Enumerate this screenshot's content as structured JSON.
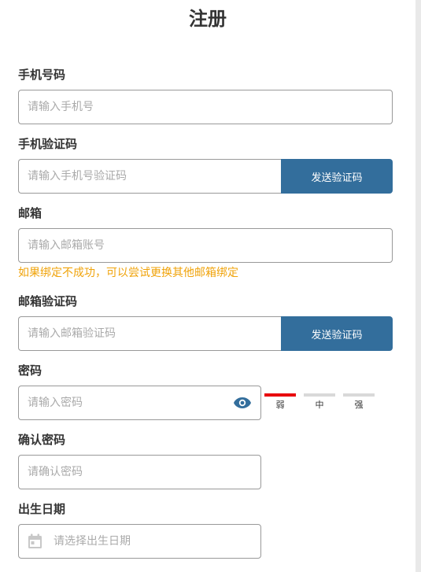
{
  "page": {
    "title": "注册"
  },
  "form": {
    "phone": {
      "label": "手机号码",
      "placeholder": "请输入手机号"
    },
    "phone_code": {
      "label": "手机验证码",
      "placeholder": "请输入手机号验证码",
      "button": "发送验证码"
    },
    "email": {
      "label": "邮箱",
      "placeholder": "请输入邮箱账号",
      "hint": "如果绑定不成功，可以尝试更换其他邮箱绑定"
    },
    "email_code": {
      "label": "邮箱验证码",
      "placeholder": "请输入邮箱验证码",
      "button": "发送验证码"
    },
    "password": {
      "label": "密码",
      "placeholder": "请输入密码",
      "toggle_icon": "eye-icon",
      "strength": [
        {
          "label": "弱",
          "color": "#e8000b",
          "active": true
        },
        {
          "label": "中",
          "color": "#d9d9d9",
          "active": false
        },
        {
          "label": "强",
          "color": "#d9d9d9",
          "active": false
        }
      ]
    },
    "confirm_password": {
      "label": "确认密码",
      "placeholder": "请确认密码"
    },
    "birthday": {
      "label": "出生日期",
      "placeholder": "请选择出生日期",
      "icon": "calendar-icon"
    }
  },
  "colors": {
    "accent": "#336e9c",
    "hint": "#f0a30a",
    "border": "#999999"
  }
}
